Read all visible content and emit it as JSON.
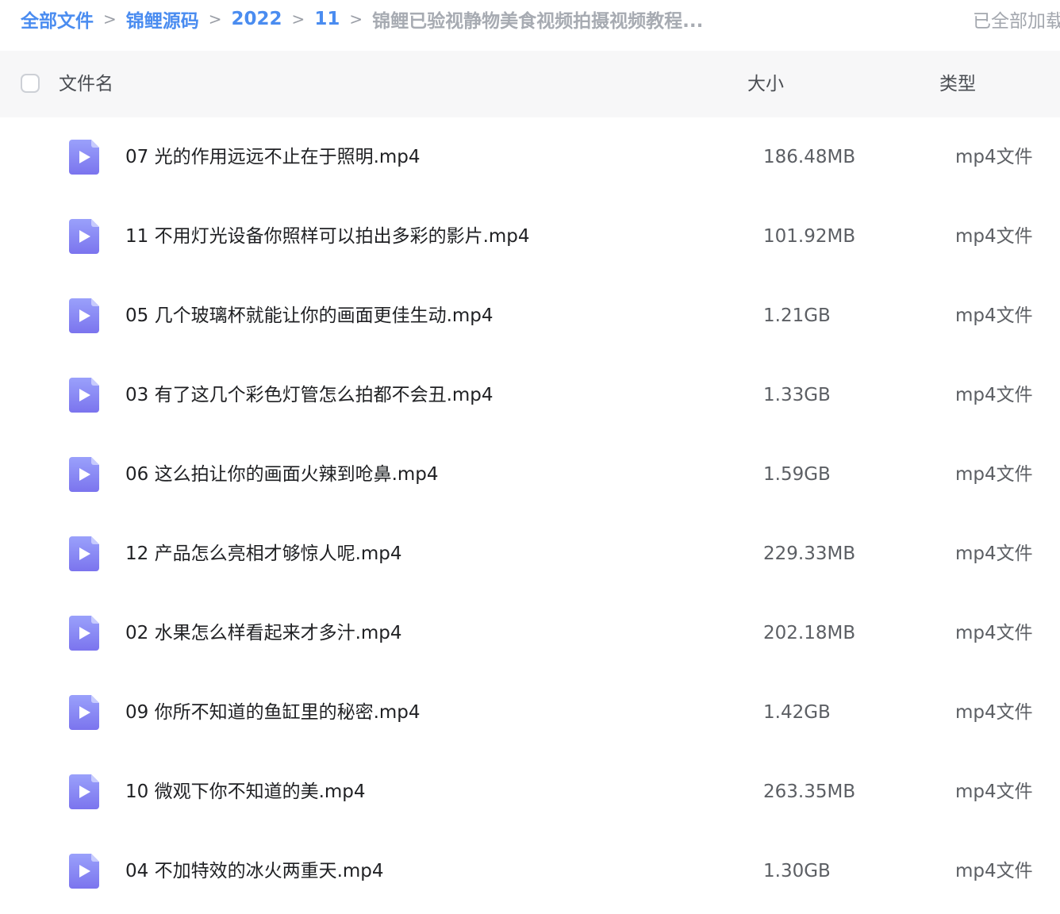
{
  "breadcrumb": {
    "items": [
      "全部文件",
      "锦鲤源码",
      "2022",
      "11"
    ],
    "current": "锦鲤已验视静物美食视频拍摄视频教程...",
    "separator": ">"
  },
  "status": "已全部加载",
  "table": {
    "headers": {
      "name": "文件名",
      "size": "大小",
      "type": "类型"
    },
    "rows": [
      {
        "name": "07 光的作用远远不止在于照明.mp4",
        "size": "186.48MB",
        "type": "mp4文件"
      },
      {
        "name": "11 不用灯光设备你照样可以拍出多彩的影片.mp4",
        "size": "101.92MB",
        "type": "mp4文件"
      },
      {
        "name": "05 几个玻璃杯就能让你的画面更佳生动.mp4",
        "size": "1.21GB",
        "type": "mp4文件"
      },
      {
        "name": "03 有了这几个彩色灯管怎么拍都不会丑.mp4",
        "size": "1.33GB",
        "type": "mp4文件"
      },
      {
        "name": "06 这么拍让你的画面火辣到呛鼻.mp4",
        "size": "1.59GB",
        "type": "mp4文件"
      },
      {
        "name": "12 产品怎么亮相才够惊人呢.mp4",
        "size": "229.33MB",
        "type": "mp4文件"
      },
      {
        "name": "02 水果怎么样看起来才多汁.mp4",
        "size": "202.18MB",
        "type": "mp4文件"
      },
      {
        "name": "09 你所不知道的鱼缸里的秘密.mp4",
        "size": "1.42GB",
        "type": "mp4文件"
      },
      {
        "name": "10 微观下你不知道的美.mp4",
        "size": "263.35MB",
        "type": "mp4文件"
      },
      {
        "name": "04 不加特效的冰火两重天.mp4",
        "size": "1.30GB",
        "type": "mp4文件"
      }
    ]
  },
  "icons": {
    "file": "video-file-icon"
  },
  "colors": {
    "link": "#4a8cf0",
    "icon_top": "#9aa1fb",
    "icon_bottom": "#7b74ee",
    "header_bg": "#f7f7f8"
  }
}
